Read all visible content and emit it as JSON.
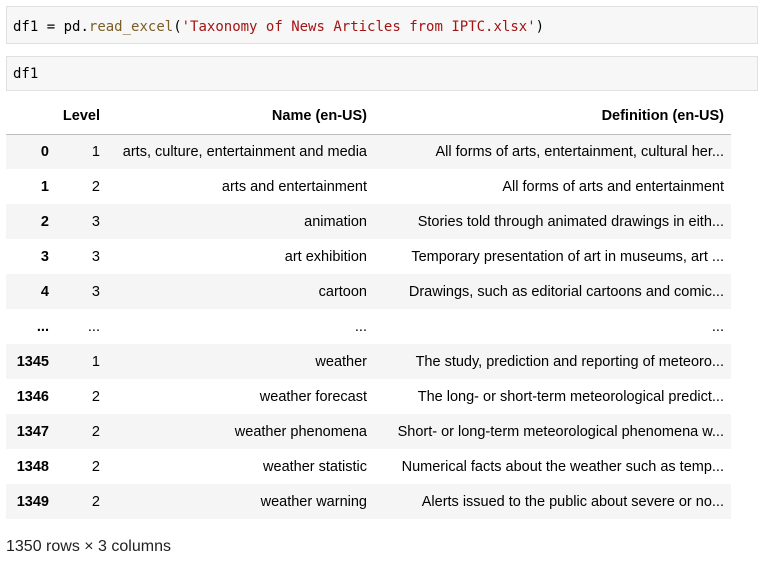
{
  "cells": [
    {
      "tokens": [
        "df1",
        " = ",
        "pd",
        ".",
        "read_excel",
        "(",
        "'Taxonomy of News Articles from IPTC.xlsx'",
        ")"
      ]
    },
    {
      "tokens": [
        "df1"
      ]
    }
  ],
  "dataframe": {
    "columns": [
      "",
      "Level",
      "Name (en-US)",
      "Definition (en-US)"
    ],
    "rows": [
      {
        "index": "0",
        "level": "1",
        "name": "arts, culture, entertainment and media",
        "definition": "All forms of arts, entertainment, cultural her..."
      },
      {
        "index": "1",
        "level": "2",
        "name": "arts and entertainment",
        "definition": "All forms of arts and entertainment"
      },
      {
        "index": "2",
        "level": "3",
        "name": "animation",
        "definition": "Stories told through animated drawings in eith..."
      },
      {
        "index": "3",
        "level": "3",
        "name": "art exhibition",
        "definition": "Temporary presentation of art in museums, art ..."
      },
      {
        "index": "4",
        "level": "3",
        "name": "cartoon",
        "definition": "Drawings, such as editorial cartoons and comic..."
      },
      {
        "index": "...",
        "level": "...",
        "name": "...",
        "definition": "..."
      },
      {
        "index": "1345",
        "level": "1",
        "name": "weather",
        "definition": "The study, prediction and reporting of meteoro..."
      },
      {
        "index": "1346",
        "level": "2",
        "name": "weather forecast",
        "definition": "The long- or short-term meteorological predict..."
      },
      {
        "index": "1347",
        "level": "2",
        "name": "weather phenomena",
        "definition": "Short- or long-term meteorological phenomena w..."
      },
      {
        "index": "1348",
        "level": "2",
        "name": "weather statistic",
        "definition": "Numerical facts about the weather such as temp..."
      },
      {
        "index": "1349",
        "level": "2",
        "name": "weather warning",
        "definition": "Alerts issued to the public about severe or no..."
      }
    ],
    "shape_text": "1350 rows × 3 columns"
  }
}
